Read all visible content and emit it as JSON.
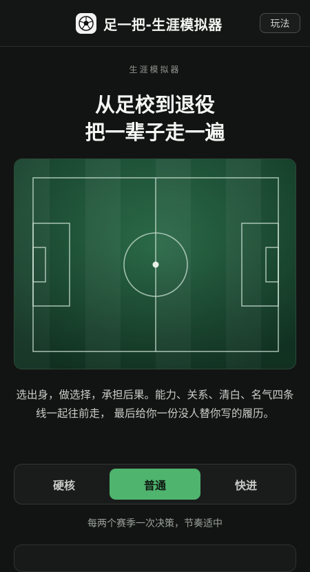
{
  "header": {
    "logo_icon": "soccer-ball-icon",
    "title": "足一把-生涯模拟器",
    "howto_label": "玩法"
  },
  "hero": {
    "eyebrow": "生涯模拟器",
    "headline_line1": "从足校到退役",
    "headline_line2": "把一辈子走一遍"
  },
  "pitch": {
    "image": "soccer-pitch-illustration",
    "grass_colors": [
      "#2b6a4a",
      "#245c40"
    ],
    "line_color": "#cfe3d6"
  },
  "description": "选出身，做选择，承担后果。能力、关系、清白、名气四条线一起往前走， 最后给你一份没人替你写的履历。",
  "modes": {
    "options": [
      "硬核",
      "普通",
      "快进"
    ],
    "selected": "普通",
    "note": "每两个赛季一次决策，节奏适中"
  },
  "colors": {
    "background": "#121413",
    "accent": "#4fb46e"
  }
}
